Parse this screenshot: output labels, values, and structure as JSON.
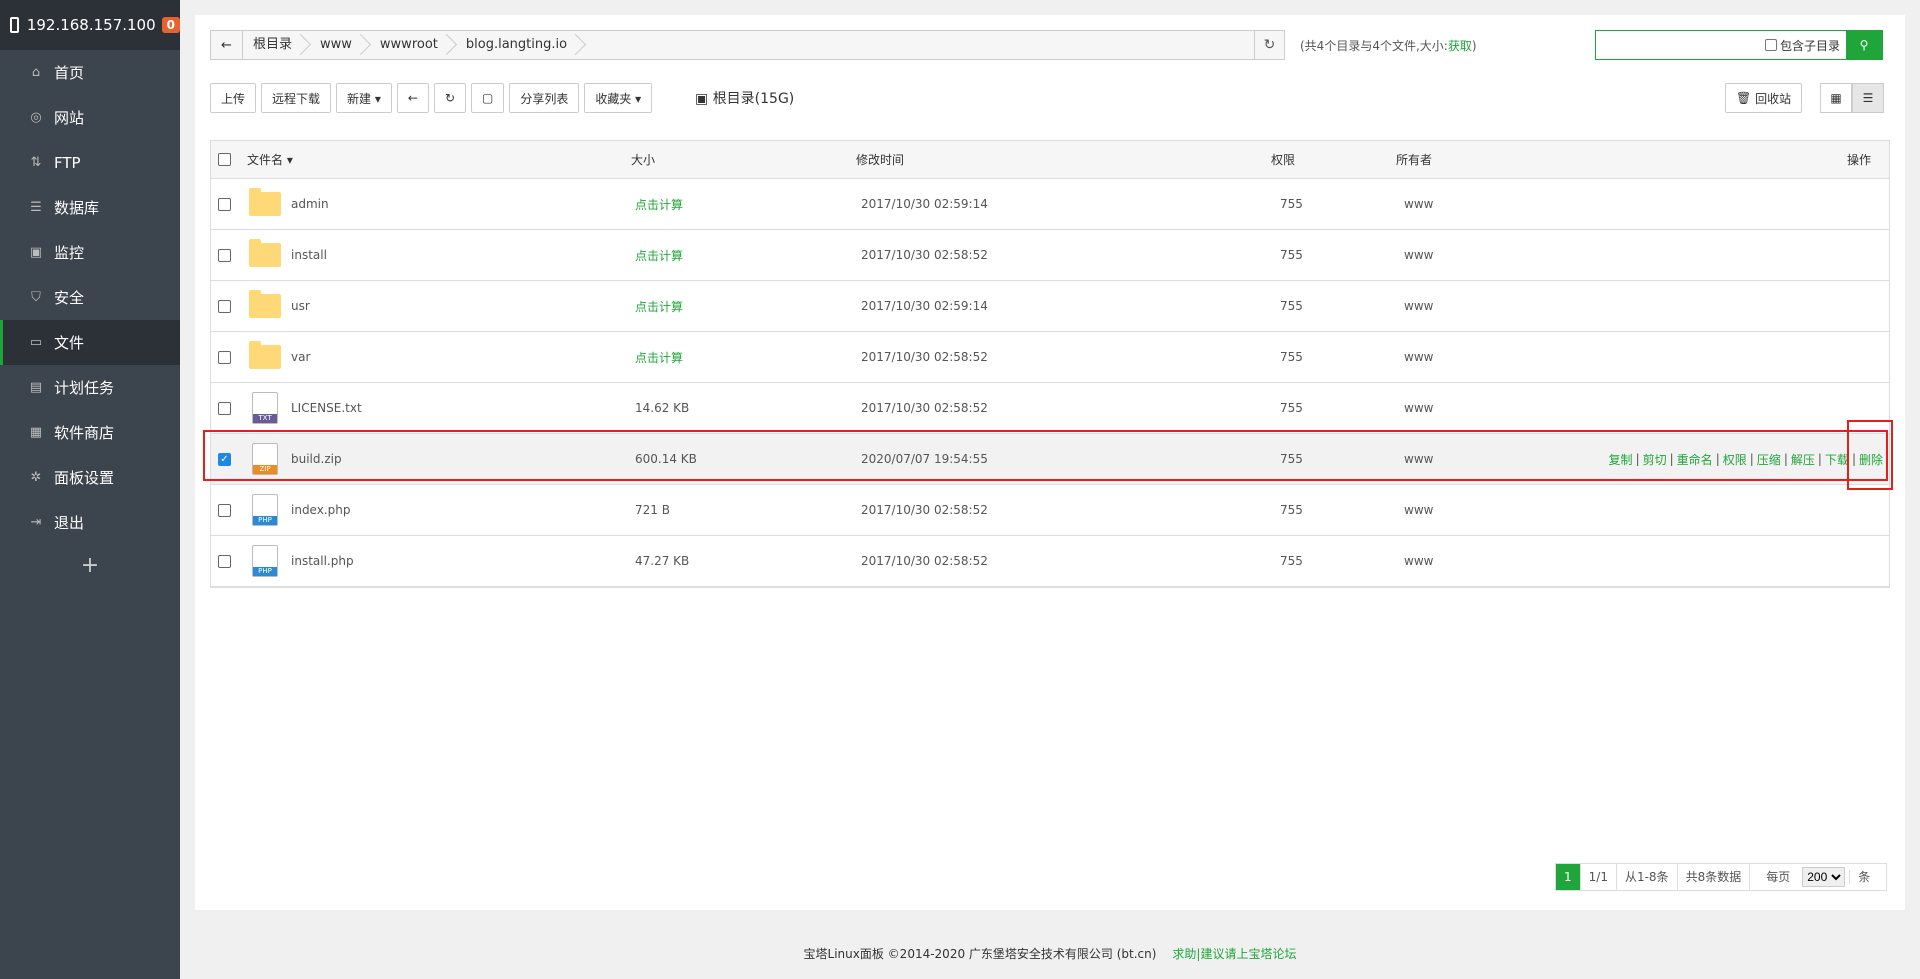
{
  "sidebar": {
    "host": "192.168.157.100",
    "badge": "0",
    "items": [
      {
        "label": "首页",
        "icon": "home-icon",
        "glyph": "⌂"
      },
      {
        "label": "网站",
        "icon": "globe-icon",
        "glyph": "◎"
      },
      {
        "label": "FTP",
        "icon": "ftp-icon",
        "glyph": "⇅"
      },
      {
        "label": "数据库",
        "icon": "database-icon",
        "glyph": "☰"
      },
      {
        "label": "监控",
        "icon": "monitor-icon",
        "glyph": "▣"
      },
      {
        "label": "安全",
        "icon": "shield-icon",
        "glyph": "⛉"
      },
      {
        "label": "文件",
        "icon": "folder-icon",
        "glyph": "▭"
      },
      {
        "label": "计划任务",
        "icon": "calendar-icon",
        "glyph": "▤"
      },
      {
        "label": "软件商店",
        "icon": "apps-icon",
        "glyph": "▦"
      },
      {
        "label": "面板设置",
        "icon": "gear-icon",
        "glyph": "✲"
      },
      {
        "label": "退出",
        "icon": "logout-icon",
        "glyph": "⇥"
      }
    ],
    "active_index": 6,
    "plus": "+"
  },
  "path": {
    "crumbs": [
      "根目录",
      "www",
      "wwwroot",
      "blog.langting.io"
    ],
    "info_prefix": "(共4个目录与4个文件,大小:",
    "info_link": "获取",
    "info_suffix": ")"
  },
  "search": {
    "placeholder": "",
    "include_sub": "包含子目录"
  },
  "toolbar": {
    "upload": "上传",
    "remote_download": "远程下载",
    "new": "新建 ▾",
    "share_list": "分享列表",
    "favorites": "收藏夹 ▾",
    "root_info": "根目录(15G)",
    "recycle": "回收站"
  },
  "table": {
    "headers": {
      "name": "文件名 ▾",
      "size": "大小",
      "mtime": "修改时间",
      "perm": "权限",
      "owner": "所有者",
      "ops": "操作"
    },
    "rows": [
      {
        "name": "admin",
        "type": "folder",
        "size": "点击计算",
        "mtime": "2017/10/30 02:59:14",
        "perm": "755",
        "owner": "www"
      },
      {
        "name": "install",
        "type": "folder",
        "size": "点击计算",
        "mtime": "2017/10/30 02:58:52",
        "perm": "755",
        "owner": "www"
      },
      {
        "name": "usr",
        "type": "folder",
        "size": "点击计算",
        "mtime": "2017/10/30 02:59:14",
        "perm": "755",
        "owner": "www"
      },
      {
        "name": "var",
        "type": "folder",
        "size": "点击计算",
        "mtime": "2017/10/30 02:58:52",
        "perm": "755",
        "owner": "www"
      },
      {
        "name": "LICENSE.txt",
        "type": "txt",
        "size": "14.62 KB",
        "mtime": "2017/10/30 02:58:52",
        "perm": "755",
        "owner": "www"
      },
      {
        "name": "build.zip",
        "type": "zip",
        "size": "600.14 KB",
        "mtime": "2020/07/07 19:54:55",
        "perm": "755",
        "owner": "www",
        "selected": true
      },
      {
        "name": "index.php",
        "type": "php",
        "size": "721 B",
        "mtime": "2017/10/30 02:58:52",
        "perm": "755",
        "owner": "www"
      },
      {
        "name": "install.php",
        "type": "php",
        "size": "47.27 KB",
        "mtime": "2017/10/30 02:58:52",
        "perm": "755",
        "owner": "www"
      }
    ],
    "row_ops": [
      "复制",
      "剪切",
      "重命名",
      "权限",
      "压缩",
      "解压",
      "下载",
      "删除"
    ],
    "file_tags": {
      "txt": "TXT",
      "zip": "ZIP",
      "php": "PHP"
    }
  },
  "pager": {
    "current": "1",
    "pages": "1/1",
    "range": "从1-8条",
    "total": "共8条数据",
    "per_page_label": "每页",
    "per_page_value": "200",
    "unit": "条"
  },
  "footer": {
    "copyright": "宝塔Linux面板 ©2014-2020 广东堡塔安全技术有限公司 (bt.cn)",
    "link": "求助|建议请上宝塔论坛"
  }
}
